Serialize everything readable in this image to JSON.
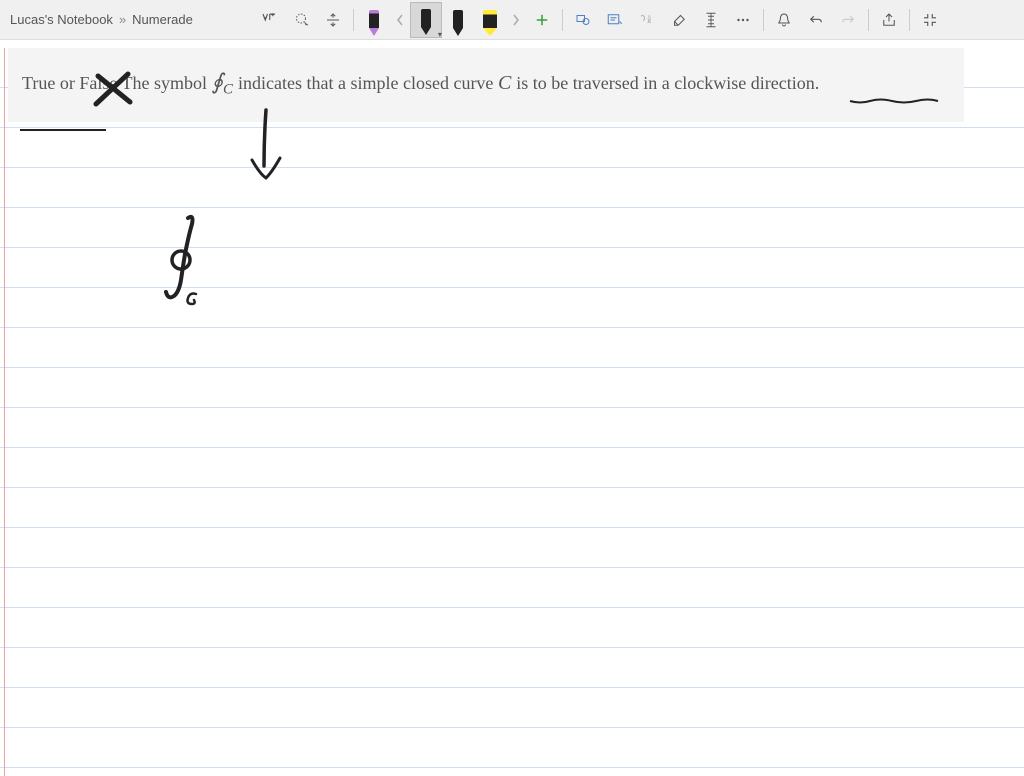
{
  "breadcrumb": {
    "notebook": "Lucas's Notebook",
    "separator": "»",
    "page": "Numerade"
  },
  "toolbar": {
    "textInsert": "Insert Text",
    "lasso": "Lasso Select",
    "insertSpace": "Insert Space",
    "penPurple": "Purple Pen",
    "penBlack": "Black Pen",
    "penBlack2": "Black Pen 2",
    "highlighterYellow": "Yellow Highlighter",
    "addPen": "Add Pen",
    "inkToShape": "Ink to Shape",
    "inkToText": "Ink to Text",
    "inkToMath": "Ink to Math",
    "eraser": "Eraser",
    "ruler": "Ruler",
    "more": "More",
    "notifications": "Notifications",
    "undo": "Undo",
    "redo": "Redo",
    "share": "Share",
    "fullscreen": "Exit Full Screen",
    "prevPen": "Previous",
    "nextPen": "Next"
  },
  "question": {
    "prefix": "True or False The symbol ",
    "integral": "∮",
    "subscript": "C",
    "mid": " indicates that a simple closed curve ",
    "curve": "C",
    "suffix": " is to be traversed in a clockwise direction."
  },
  "ink": {
    "crossX": "X mark over False",
    "arrow": "Arrow pointing down from integral",
    "bigIntegral": "Handwritten closed contour integral with C subscript"
  }
}
